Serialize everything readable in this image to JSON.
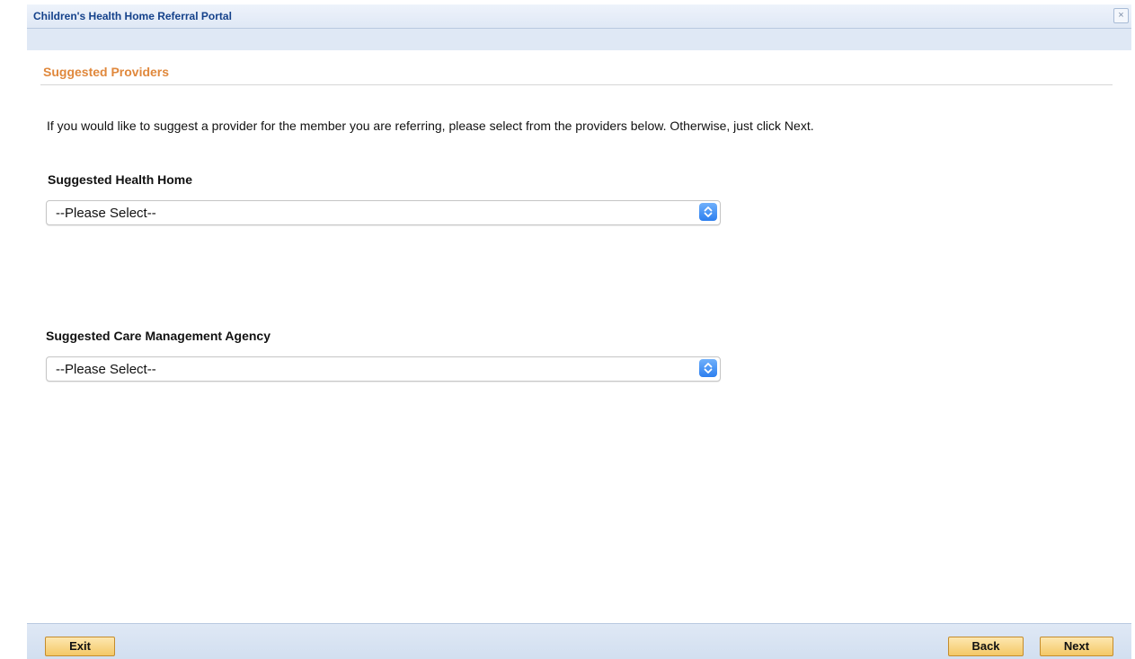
{
  "window": {
    "title": "Children's Health Home Referral Portal",
    "close_glyph": "×",
    "close_icon": "close-icon"
  },
  "section": {
    "title": "Suggested Providers",
    "title_color": "#e0883c"
  },
  "intro_text": "If you would like to suggest a provider for the member you are referring, please select from the providers below. Otherwise, just click Next.",
  "fields": {
    "health_home": {
      "label": "Suggested Health Home",
      "selected": "--Please Select--"
    },
    "care_management_agency": {
      "label": "Suggested Care Management Agency",
      "selected": "--Please Select--"
    }
  },
  "footer": {
    "exit_label": "Exit",
    "back_label": "Back",
    "next_label": "Next",
    "button_color": "#f4c866"
  }
}
